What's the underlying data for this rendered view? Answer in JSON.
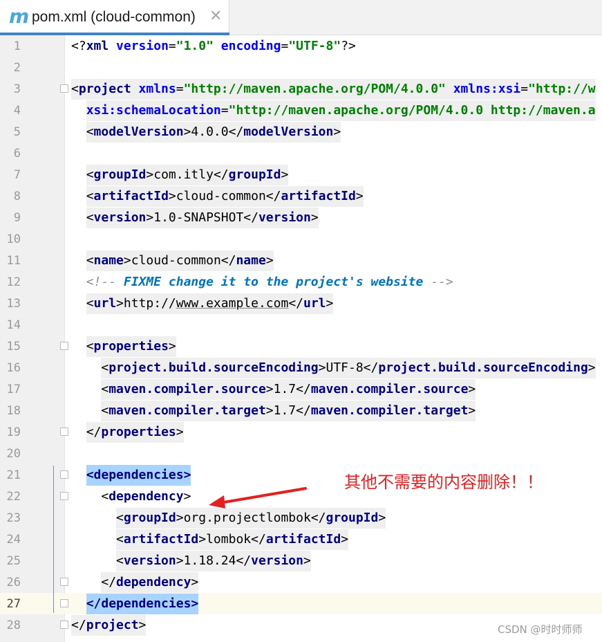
{
  "tab": {
    "icon_glyph": "m",
    "icon_name": "maven-file-icon",
    "title": "pom.xml (cloud-common)",
    "close_glyph": "✕"
  },
  "lines": {
    "1": {
      "num": "1",
      "p": [
        "<?",
        "xml ",
        "version",
        "=",
        "\"1.0\"",
        " ",
        "encoding",
        "=",
        "\"UTF-8\"",
        "?>"
      ]
    },
    "2": {
      "num": "2"
    },
    "3": {
      "num": "3",
      "p": [
        "<",
        "project ",
        "xmlns",
        "=",
        "\"http://maven.apache.org/POM/4.0.0\"",
        " ",
        "xmlns:xsi",
        "=",
        "\"http://w"
      ]
    },
    "4": {
      "num": "4",
      "p": [
        "  ",
        "xsi:schemaLocation",
        "=",
        "\"http://maven.apache.org/POM/4.0.0 http://maven.a"
      ]
    },
    "5": {
      "num": "5",
      "p": [
        "  ",
        "<",
        "modelVersion",
        ">",
        "4.0.0",
        "</",
        "modelVersion",
        ">"
      ]
    },
    "6": {
      "num": "6"
    },
    "7": {
      "num": "7",
      "p": [
        "  ",
        "<",
        "groupId",
        ">",
        "com.itly",
        "</",
        "groupId",
        ">"
      ]
    },
    "8": {
      "num": "8",
      "p": [
        "  ",
        "<",
        "artifactId",
        ">",
        "cloud-common",
        "</",
        "artifactId",
        ">"
      ]
    },
    "9": {
      "num": "9",
      "p": [
        "  ",
        "<",
        "version",
        ">",
        "1.0-SNAPSHOT",
        "</",
        "version",
        ">"
      ]
    },
    "10": {
      "num": "10"
    },
    "11": {
      "num": "11",
      "p": [
        "  ",
        "<",
        "name",
        ">",
        "cloud-common",
        "</",
        "name",
        ">"
      ]
    },
    "12": {
      "num": "12",
      "p": [
        "  ",
        "<!-- ",
        "FIXME change it to the project's website",
        " -->"
      ]
    },
    "13": {
      "num": "13",
      "p": [
        "  ",
        "<",
        "url",
        ">",
        "http://",
        "www.example.com",
        "</",
        "url",
        ">"
      ]
    },
    "14": {
      "num": "14"
    },
    "15": {
      "num": "15",
      "p": [
        "  ",
        "<",
        "properties",
        ">"
      ]
    },
    "16": {
      "num": "16",
      "p": [
        "    ",
        "<",
        "project.build.sourceEncoding",
        ">",
        "UTF-8",
        "</",
        "project.build.sourceEncoding",
        ">"
      ]
    },
    "17": {
      "num": "17",
      "p": [
        "    ",
        "<",
        "maven.compiler.source",
        ">",
        "1.7",
        "</",
        "maven.compiler.source",
        ">"
      ]
    },
    "18": {
      "num": "18",
      "p": [
        "    ",
        "<",
        "maven.compiler.target",
        ">",
        "1.7",
        "</",
        "maven.compiler.target",
        ">"
      ]
    },
    "19": {
      "num": "19",
      "p": [
        "  ",
        "</",
        "properties",
        ">"
      ]
    },
    "20": {
      "num": "20"
    },
    "21": {
      "num": "21",
      "p": [
        "  ",
        "<dependencies>"
      ]
    },
    "22": {
      "num": "22",
      "p": [
        "    ",
        "<",
        "dependency",
        ">"
      ]
    },
    "23": {
      "num": "23",
      "p": [
        "      ",
        "<",
        "groupId",
        ">",
        "org.projectlombok",
        "</",
        "groupId",
        ">"
      ]
    },
    "24": {
      "num": "24",
      "p": [
        "      ",
        "<",
        "artifactId",
        ">",
        "lombok",
        "</",
        "artifactId",
        ">"
      ]
    },
    "25": {
      "num": "25",
      "p": [
        "      ",
        "<",
        "version",
        ">",
        "1.18.24",
        "</",
        "version",
        ">"
      ]
    },
    "26": {
      "num": "26",
      "p": [
        "    ",
        "</",
        "dependency",
        ">"
      ]
    },
    "27": {
      "num": "27",
      "p": [
        "  ",
        "</dependencies>"
      ]
    },
    "28": {
      "num": "28",
      "p": [
        "</",
        "project",
        ">"
      ]
    }
  },
  "annotation": {
    "text": "其他不需要的内容删除！！",
    "color": "#e42020"
  },
  "watermark": "CSDN @时时师师",
  "colors": {
    "tag": "#000080",
    "attribute": "#0000ff",
    "string": "#008000",
    "comment": "#8c8c8c",
    "todo": "#0073bf",
    "highlight": "#a9d3ff",
    "current_line": "#fcfaed",
    "tab_underline": "#4083c9"
  }
}
